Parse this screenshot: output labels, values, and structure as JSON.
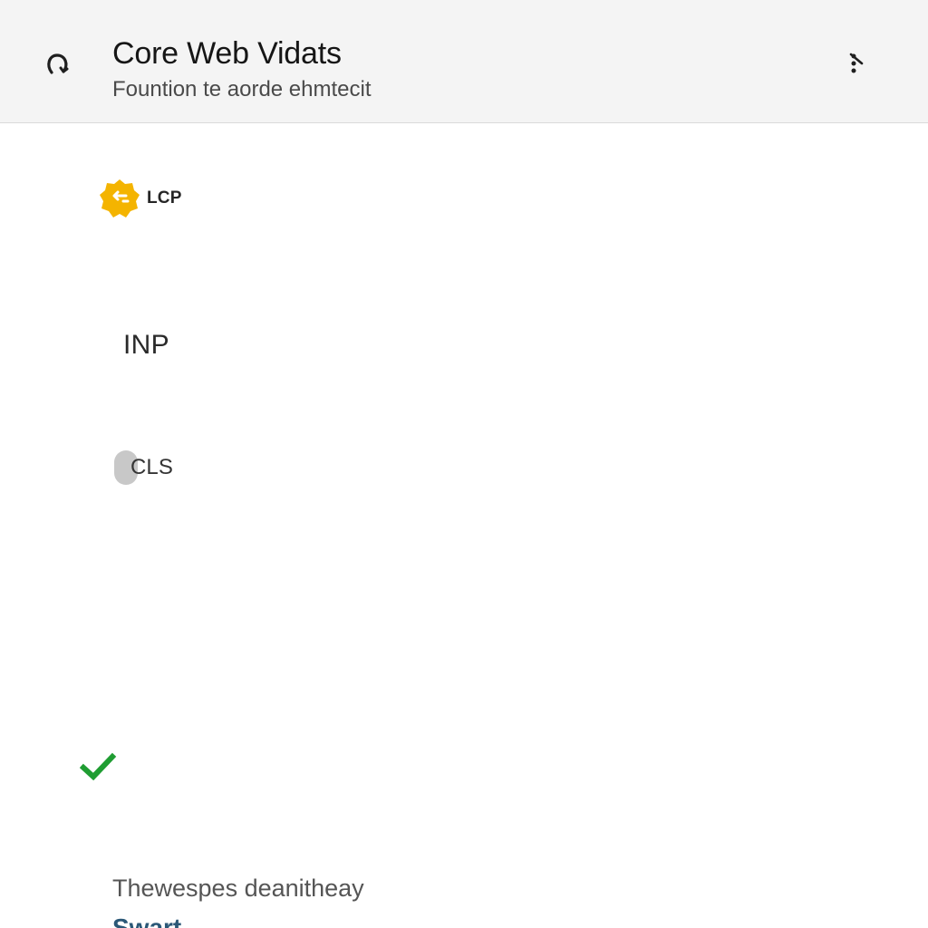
{
  "header": {
    "title": "Core Web Vidats",
    "subtitle": "Fountion te aorde ehmtecit",
    "back_icon": "back-icon",
    "menu_icon": "more-options-icon"
  },
  "metrics": [
    {
      "id": "lcp",
      "label": "LCP",
      "icon": "lcp-badge-icon",
      "accent_color": "#f4b400"
    },
    {
      "id": "inp",
      "label": "INP"
    },
    {
      "id": "cls",
      "label": "CLS",
      "icon": "cls-toggle-icon"
    }
  ],
  "status": {
    "icon": "checkmark-icon",
    "color": "#1f9d32"
  },
  "footer": {
    "text": "Thewespes deanitheay",
    "link": "Swart"
  }
}
